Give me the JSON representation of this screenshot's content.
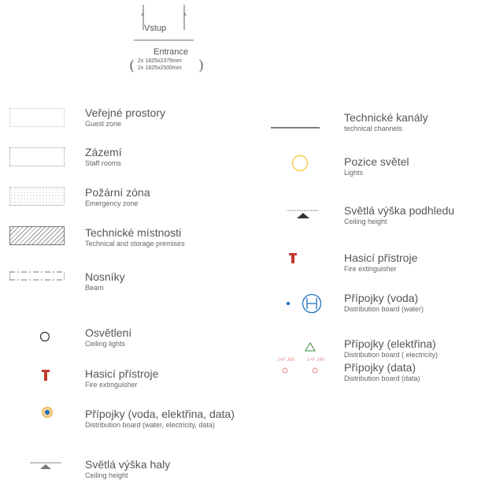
{
  "entrance": {
    "vstup": "Vstup",
    "title": "Entrance",
    "size1": "2x 1825x2375mm",
    "size2": "2x 1825x2500mm"
  },
  "left": [
    {
      "title": "Veřejné prostory",
      "sub": "Guest zone",
      "symbol": "light-dotted-rect"
    },
    {
      "title": "Zázemí",
      "sub": "Staff rooms",
      "symbol": "dotted-rect"
    },
    {
      "title": "Požární zóna",
      "sub": "Emergency zone",
      "symbol": "stippled-rect"
    },
    {
      "title": "Technické místnosti",
      "sub": "Technical and storage premises",
      "symbol": "hatched-rect"
    },
    {
      "title": "Nosníky",
      "sub": "Beam",
      "symbol": "dash-dot-beam"
    },
    {
      "title": "Osvětlení",
      "sub": "Ceiling lights",
      "symbol": "circle-outline"
    },
    {
      "title": "Hasicí přístroje",
      "sub": "Fire extinguisher",
      "symbol": "fire-extinguisher"
    },
    {
      "title": "Přípojky (voda, elektřina, data)",
      "sub": "Distribution board (water, electricity, data)",
      "symbol": "distribution-board"
    },
    {
      "title": "Světlá výška haly",
      "sub": "Ceiling height",
      "symbol": "height-marker"
    }
  ],
  "right": [
    {
      "title": "Technické kanály",
      "sub": "technical channels",
      "symbol": "line"
    },
    {
      "title": "Pozice světel",
      "sub": "Lights",
      "symbol": "yellow-circle"
    },
    {
      "title": "Světlá výška podhledu",
      "sub": "Ceiling height",
      "symbol": "height-marker"
    },
    {
      "title": "Hasicí přístroje",
      "sub": "Fire extinguisher",
      "symbol": "fire-extinguisher"
    },
    {
      "title": "Přípojky (voda)",
      "sub": "Distribution board (water)",
      "symbol": "hydrant-h"
    },
    {
      "title": "Přípojky (elektřina)",
      "sub": "Distribution board ( electricity)",
      "symbol": "triangle"
    },
    {
      "title": "Přípojky (data)",
      "sub": "Distribution board (data)",
      "symbol": "data-sockets"
    }
  ],
  "data_sockets": {
    "left": "2×F J45",
    "right": "1×F J45"
  },
  "colors": {
    "red": "#c0392b",
    "blue": "#1f5fa8",
    "green": "#3a8a3a",
    "yellow": "#f2d24b",
    "gray": "#666666"
  }
}
